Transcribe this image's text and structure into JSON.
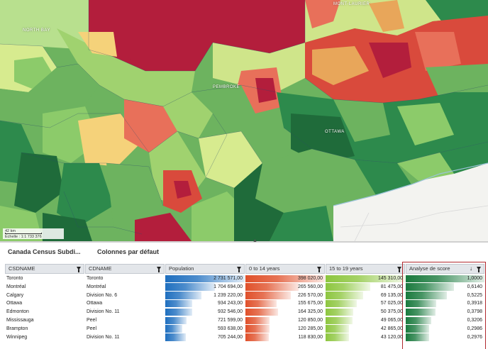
{
  "map": {
    "places": [
      "MONT-LAURIER",
      "NORTH BAY",
      "PEMBROKE",
      "OTTAWA"
    ],
    "scale": {
      "distance": "42 km",
      "ratio": "Échelle : 1:1 733 376"
    }
  },
  "panel": {
    "dataset_title": "Canada Census Subdi...",
    "columns_preset": "Colonnes par défaut"
  },
  "table": {
    "columns": [
      {
        "label": "CSDNAME"
      },
      {
        "label": "CDNAME"
      },
      {
        "label": "Population",
        "color": "#1f6fbf"
      },
      {
        "label": "0 to 14 years",
        "color": "#e0502a"
      },
      {
        "label": "15 to 19 years",
        "color": "#8dc63f"
      },
      {
        "label": "Analyse de score",
        "color": "#1a7a3e"
      }
    ],
    "rows": [
      {
        "csd": "Toronto",
        "cd": "Toronto",
        "pop": "2 731 571,00",
        "y014": "398 020,00",
        "y1519": "145 310,00",
        "score": "1,0000"
      },
      {
        "csd": "Montréal",
        "cd": "Montréal",
        "pop": "1 704 694,00",
        "y014": "265 560,00",
        "y1519": "81 475,00",
        "score": "0,6140"
      },
      {
        "csd": "Calgary",
        "cd": "Division No. 6",
        "pop": "1 239 220,00",
        "y014": "226 570,00",
        "y1519": "69 135,00",
        "score": "0,5225"
      },
      {
        "csd": "Ottawa",
        "cd": "Ottawa",
        "pop": "934 243,00",
        "y014": "155 675,00",
        "y1519": "57 025,00",
        "score": "0,3918"
      },
      {
        "csd": "Edmonton",
        "cd": "Division No. 11",
        "pop": "932 546,00",
        "y014": "164 325,00",
        "y1519": "50 375,00",
        "score": "0,3798"
      },
      {
        "csd": "Mississauga",
        "cd": "Peel",
        "pop": "721 599,00",
        "y014": "120 850,00",
        "y1519": "49 065,00",
        "score": "0,3206"
      },
      {
        "csd": "Brampton",
        "cd": "Peel",
        "pop": "593 638,00",
        "y014": "120 285,00",
        "y1519": "42 865,00",
        "score": "0,2986"
      },
      {
        "csd": "Winnipeg",
        "cd": "Division No. 11",
        "pop": "705 244,00",
        "y014": "118 830,00",
        "y1519": "43 120,00",
        "score": "0,2976"
      }
    ],
    "max": {
      "pop": 2731571,
      "y014": 398020,
      "y1519": 145310,
      "score": 1.0
    }
  }
}
